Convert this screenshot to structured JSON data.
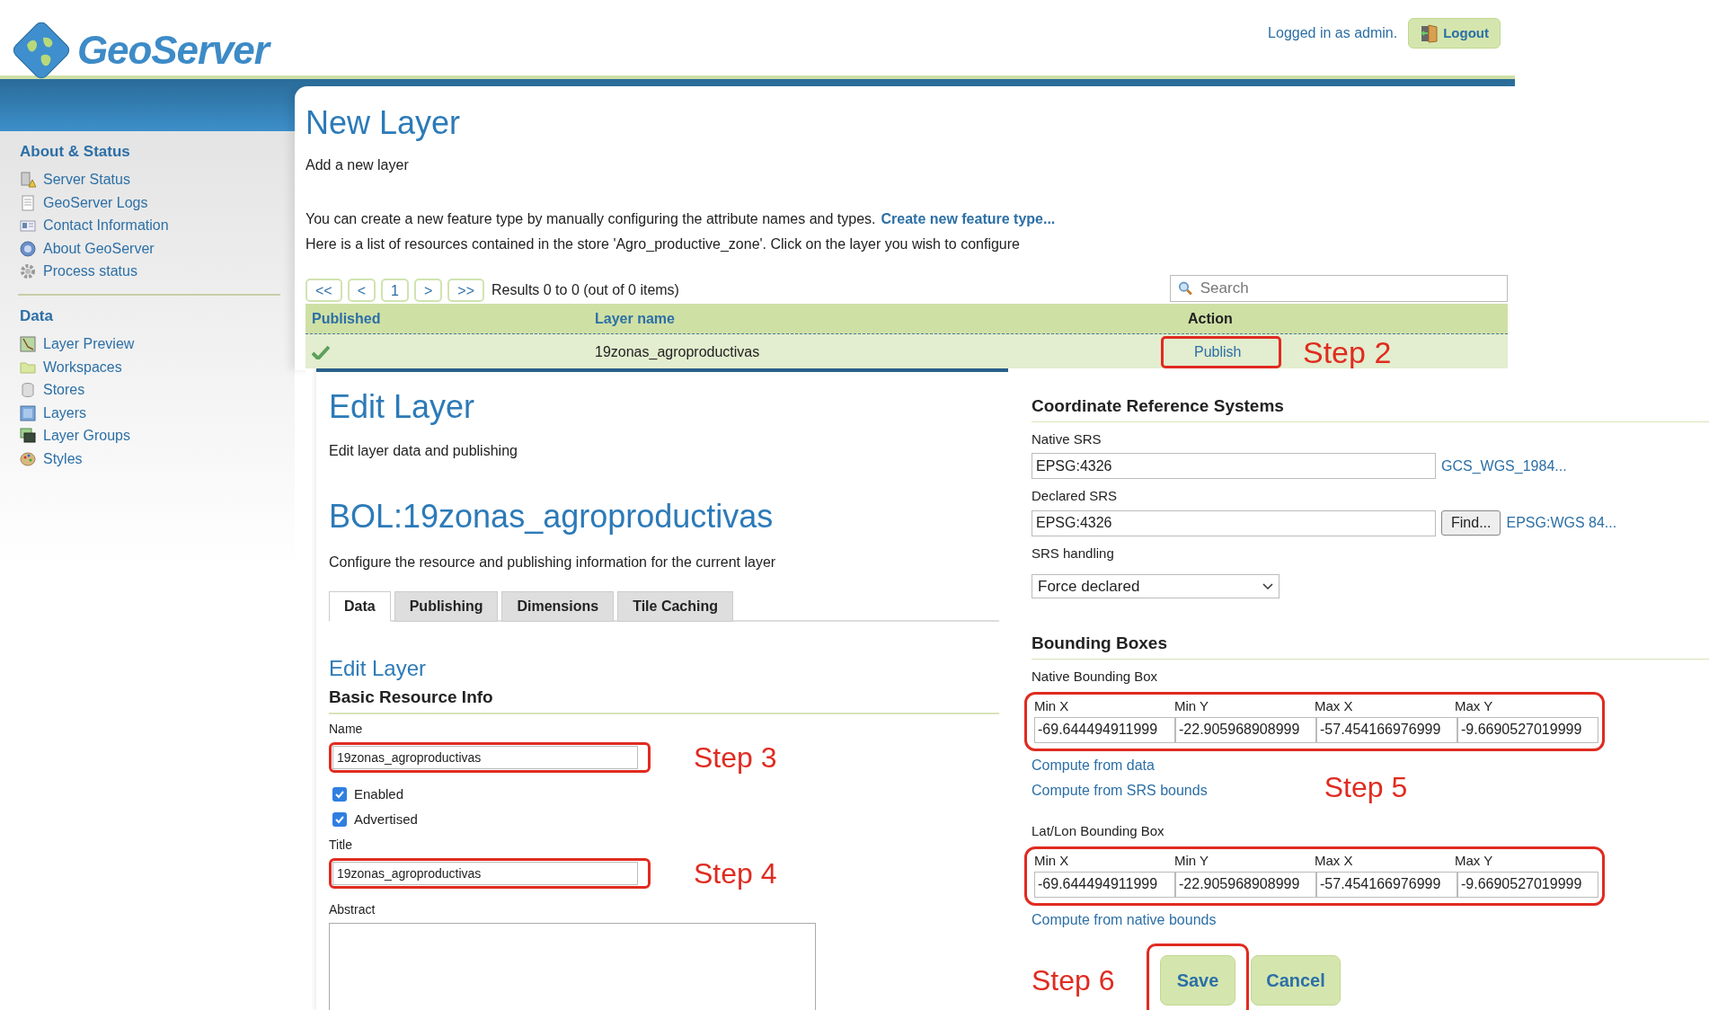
{
  "header": {
    "logo_text": "GeoServer",
    "login_text": "Logged in as admin.",
    "logout_button": "Logout"
  },
  "sidebar": {
    "sections": [
      {
        "title": "About & Status",
        "items": [
          {
            "label": "Server Status"
          },
          {
            "label": "GeoServer Logs"
          },
          {
            "label": "Contact Information"
          },
          {
            "label": "About GeoServer"
          },
          {
            "label": "Process status"
          }
        ]
      },
      {
        "title": "Data",
        "items": [
          {
            "label": "Layer Preview"
          },
          {
            "label": "Workspaces"
          },
          {
            "label": "Stores"
          },
          {
            "label": "Layers"
          },
          {
            "label": "Layer Groups"
          },
          {
            "label": "Styles"
          }
        ]
      }
    ]
  },
  "new_layer": {
    "title": "New Layer",
    "subtitle": "Add a new layer",
    "intro_text": "You can create a new feature type by manually configuring the attribute names and types.",
    "intro_link": "Create new feature type...",
    "list_text": "Here is a list of resources contained in the store 'Agro_productive_zone'. Click on the layer you wish to configure",
    "pager": {
      "buttons": [
        "<<",
        "<",
        "1",
        ">",
        ">>"
      ],
      "results": "Results 0 to 0 (out of 0 items)"
    },
    "search": {
      "placeholder": "Search"
    },
    "table": {
      "columns": [
        "Published",
        "Layer name",
        "Action"
      ],
      "rows": [
        {
          "published": true,
          "layer_name": "19zonas_agroproductivas",
          "action": "Publish"
        }
      ],
      "annotation": "Step 2"
    }
  },
  "edit_layer": {
    "title": "Edit Layer",
    "subtitle": "Edit layer data and publishing",
    "layer_title": "BOL:19zonas_agroproductivas",
    "description": "Configure the resource and publishing information for the current layer",
    "tabs": [
      {
        "label": "Data",
        "selected": true
      },
      {
        "label": "Publishing",
        "selected": false
      },
      {
        "label": "Dimensions",
        "selected": false
      },
      {
        "label": "Tile Caching",
        "selected": false
      }
    ],
    "section_title": "Edit Layer",
    "subsection_title": "Basic Resource Info",
    "name_field": {
      "label": "Name",
      "value": "19zonas_agroproductivas",
      "annotation": "Step 3"
    },
    "checkboxes": [
      {
        "label": "Enabled",
        "checked": true
      },
      {
        "label": "Advertised",
        "checked": true
      }
    ],
    "title_field": {
      "label": "Title",
      "value": "19zonas_agroproductivas",
      "annotation": "Step 4"
    },
    "abstract_field": {
      "label": "Abstract"
    },
    "crs": {
      "heading": "Coordinate Reference Systems",
      "native_srs": {
        "label": "Native SRS",
        "value": "EPSG:4326",
        "link": "GCS_WGS_1984..."
      },
      "declared_srs": {
        "label": "Declared SRS",
        "value": "EPSG:4326",
        "button": "Find...",
        "link": "EPSG:WGS 84..."
      },
      "srs_handling": {
        "label": "SRS handling",
        "value": "Force declared"
      }
    },
    "bounding_boxes": {
      "heading": "Bounding Boxes",
      "annotation": "Step 5",
      "boxes": [
        {
          "label": "Native Bounding Box",
          "columns": [
            "Min X",
            "Min Y",
            "Max X",
            "Max Y"
          ],
          "values": [
            "-69.644494911999",
            "-22.905968908999",
            "-57.454166976999",
            "-9.6690527019999"
          ],
          "links": [
            "Compute from data",
            "Compute from SRS bounds"
          ]
        },
        {
          "label": "Lat/Lon Bounding Box",
          "columns": [
            "Min X",
            "Min Y",
            "Max X",
            "Max Y"
          ],
          "values": [
            "-69.644494911999",
            "-22.905968908999",
            "-57.454166976999",
            "-9.6690527019999"
          ],
          "links": [
            "Compute from native bounds"
          ]
        }
      ]
    },
    "buttons": {
      "save": "Save",
      "cancel": "Cancel",
      "annotation": "Step 6"
    }
  }
}
